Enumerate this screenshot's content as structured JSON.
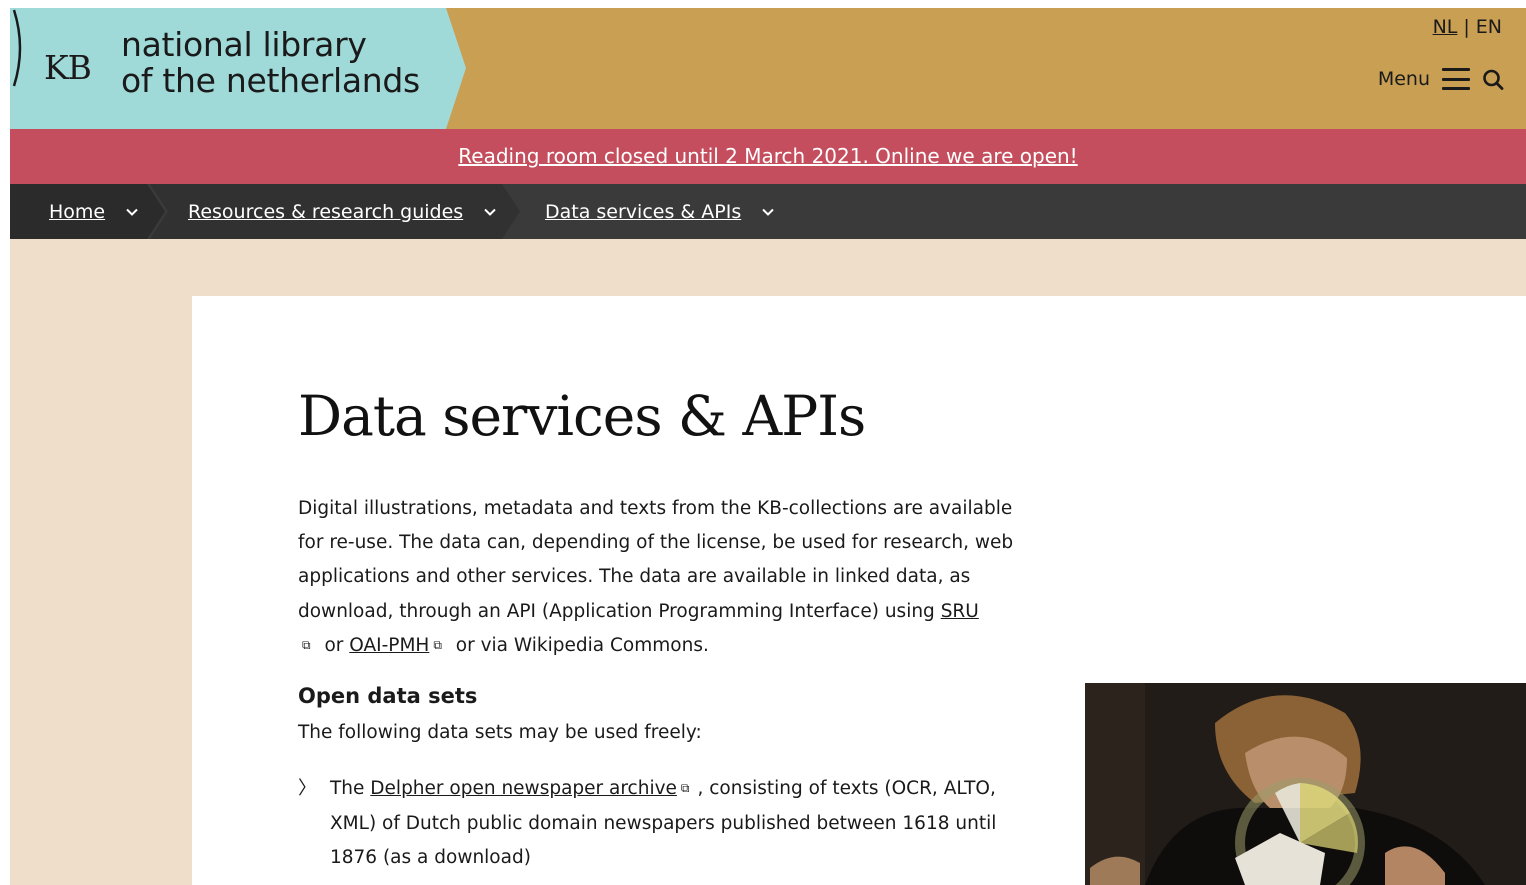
{
  "header": {
    "logo_kb": "KB",
    "logo_line1": "national library",
    "logo_line2": "of the netherlands",
    "lang_nl": "NL",
    "lang_sep": "|",
    "lang_en": "EN",
    "menu_label": "Menu"
  },
  "banner": {
    "text": "Reading room closed until 2 March 2021. Online we are open!"
  },
  "breadcrumb": {
    "items": [
      {
        "label": "Home"
      },
      {
        "label": "Resources & research guides"
      },
      {
        "label": "Data services & APIs"
      }
    ]
  },
  "main": {
    "title": "Data services & APIs",
    "intro_part1": "Digital illustrations, metadata and texts from the KB-collections are available for re-use. The data can, depending of the license, be used for research, web applications and other services. The data are available in linked data, as download, through an API (Application Programming Interface) using ",
    "sru_link": "SRU",
    "intro_or": " or ",
    "oai_link": "OAI-PMH",
    "intro_part2": " or via Wikipedia Commons.",
    "section_title": "Open data sets",
    "section_lead": "The following data sets may be used freely:",
    "list_bullet": "〉",
    "item1_prefix": "The ",
    "item1_link": "Delpher open newspaper archive",
    "item1_text": ", consisting of texts (OCR, ALTO, XML) of Dutch public domain newspapers published between 1618 until 1876 (as a download)"
  },
  "colors": {
    "logo_bg": "#9fdad9",
    "header_bg": "#c99f53",
    "banner_bg": "#c44e5d",
    "breadcrumb_bg": "#3a3a3a",
    "page_bg": "#efdeca"
  },
  "icons": {
    "external_link": "external-link-icon",
    "hamburger": "hamburger-icon",
    "search": "search-icon",
    "chevron": "chevron-down-icon"
  }
}
